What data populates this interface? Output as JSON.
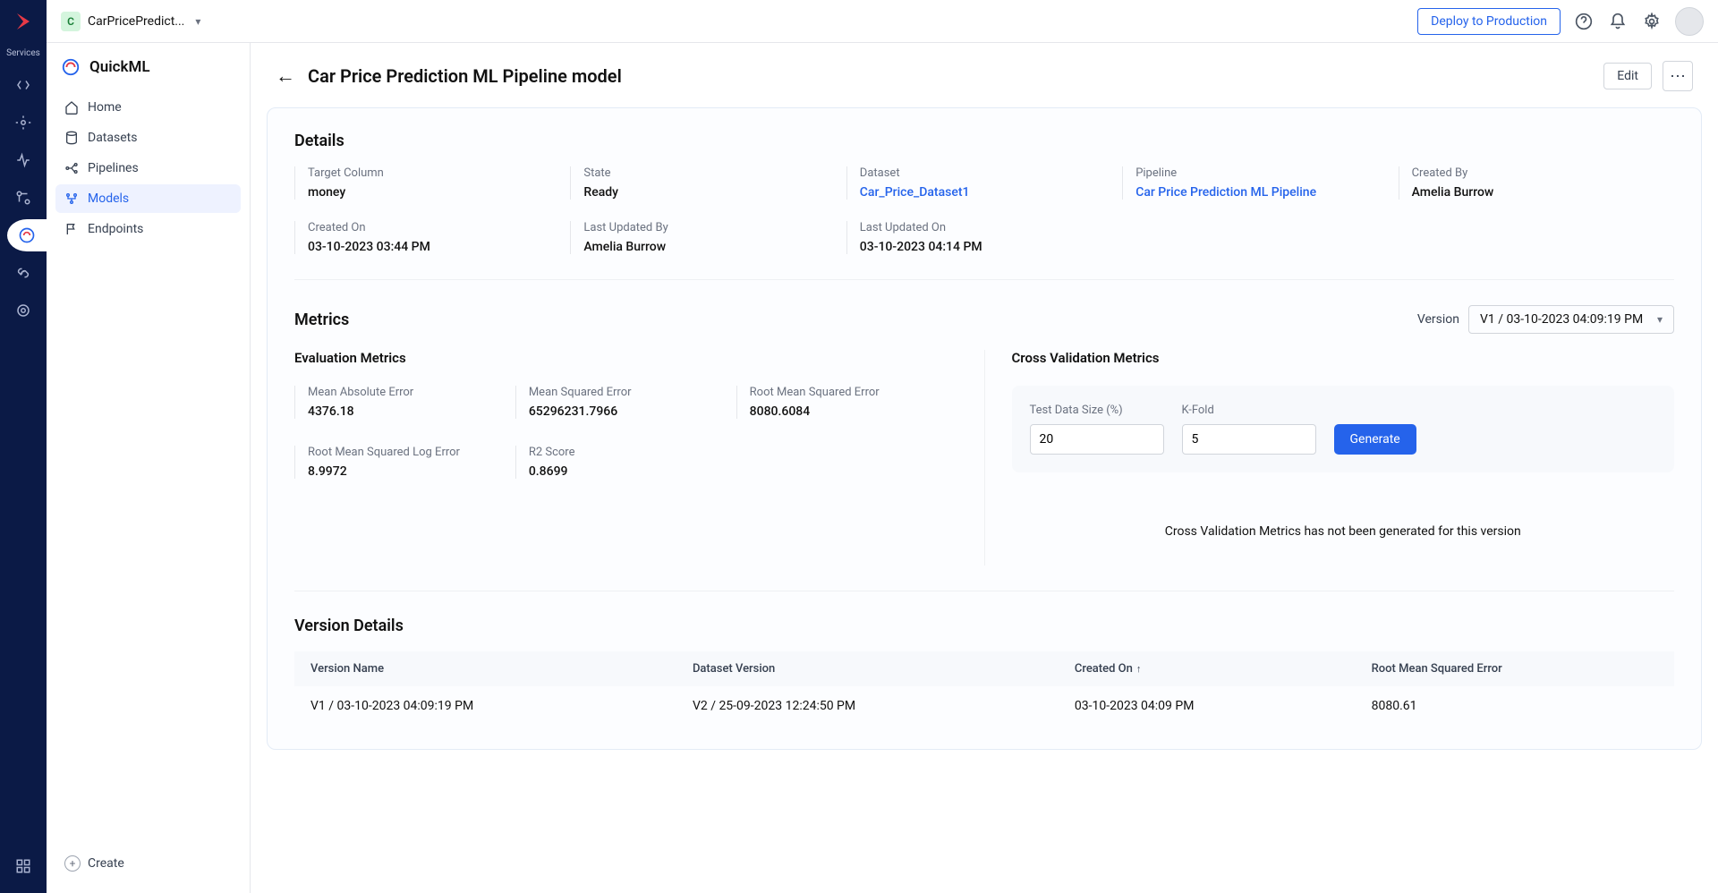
{
  "topbar": {
    "project_badge": "C",
    "project_name": "CarPricePredict...",
    "deploy_label": "Deploy to Production"
  },
  "rail": {
    "services_label": "Services"
  },
  "sidebar": {
    "title": "QuickML",
    "items": [
      {
        "label": "Home"
      },
      {
        "label": "Datasets"
      },
      {
        "label": "Pipelines"
      },
      {
        "label": "Models"
      },
      {
        "label": "Endpoints"
      }
    ],
    "create_label": "Create"
  },
  "page": {
    "title": "Car Price Prediction ML Pipeline model",
    "edit_label": "Edit"
  },
  "details": {
    "title": "Details",
    "row1": [
      {
        "label": "Target Column",
        "value": "money",
        "link": false
      },
      {
        "label": "State",
        "value": "Ready",
        "link": false
      },
      {
        "label": "Dataset",
        "value": "Car_Price_Dataset1",
        "link": true
      },
      {
        "label": "Pipeline",
        "value": "Car Price Prediction ML Pipeline",
        "link": true
      },
      {
        "label": "Created By",
        "value": "Amelia Burrow",
        "link": false
      }
    ],
    "row2": [
      {
        "label": "Created On",
        "value": "03-10-2023 03:44 PM"
      },
      {
        "label": "Last Updated By",
        "value": "Amelia Burrow"
      },
      {
        "label": "Last Updated On",
        "value": "03-10-2023 04:14 PM"
      }
    ]
  },
  "metrics": {
    "title": "Metrics",
    "version_label": "Version",
    "version_selected": "V1 / 03-10-2023 04:09:19 PM",
    "eval_title": "Evaluation Metrics",
    "eval": [
      {
        "label": "Mean Absolute Error",
        "value": "4376.18"
      },
      {
        "label": "Mean Squared Error",
        "value": "65296231.7966"
      },
      {
        "label": "Root Mean Squared Error",
        "value": "8080.6084"
      },
      {
        "label": "Root Mean Squared Log Error",
        "value": "8.9972"
      },
      {
        "label": "R2 Score",
        "value": "0.8699"
      }
    ],
    "cv_title": "Cross Validation Metrics",
    "cv_test_label": "Test Data Size (%)",
    "cv_test_value": "20",
    "cv_kfold_label": "K-Fold",
    "cv_kfold_value": "5",
    "cv_generate": "Generate",
    "cv_msg": "Cross Validation Metrics has not been generated for this version"
  },
  "versions": {
    "title": "Version Details",
    "headers": [
      "Version Name",
      "Dataset Version",
      "Created On",
      "Root Mean Squared Error"
    ],
    "rows": [
      {
        "name": "V1 / 03-10-2023 04:09:19 PM",
        "dataset": "V2 / 25-09-2023 12:24:50 PM",
        "created": "03-10-2023 04:09 PM",
        "rmse": "8080.61"
      }
    ]
  }
}
